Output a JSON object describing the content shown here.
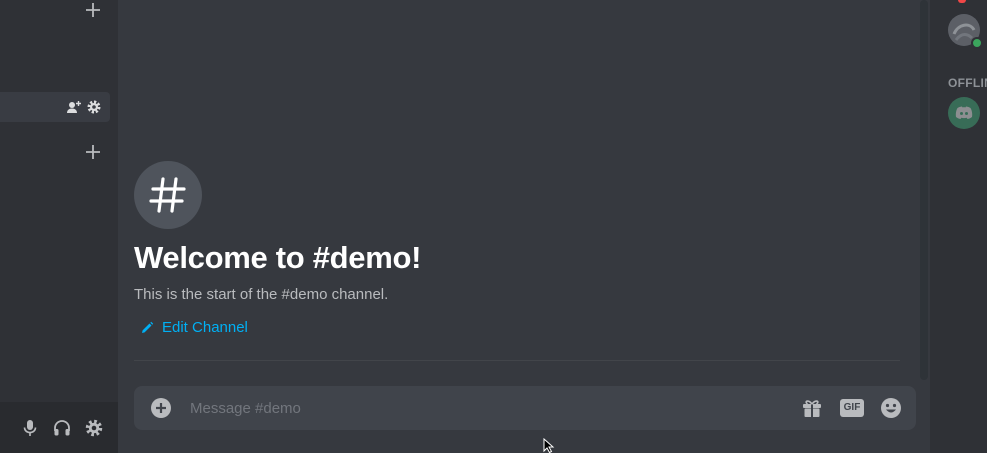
{
  "sidebar": {
    "add_top_icon": "plus-icon",
    "add_mid_icon": "plus-icon",
    "channel_row": {
      "invite_icon": "add-user-icon",
      "settings_icon": "gear-icon"
    },
    "user_panel": {
      "mic_icon": "microphone-icon",
      "headphones_icon": "headphones-icon",
      "settings_icon": "gear-icon"
    }
  },
  "chat": {
    "welcome_title": "Welcome to #demo!",
    "welcome_subtitle": "This is the start of the #demo channel.",
    "edit_channel_label": "Edit Channel",
    "channel_icon": "hash-icon"
  },
  "composer": {
    "placeholder": "Message #demo",
    "value": "",
    "gift_icon": "gift-icon",
    "gif_label": "GIF",
    "emoji_icon": "emoji-icon",
    "attach_icon": "plus-circle-icon"
  },
  "members": {
    "offline_header": "OFFLIN",
    "online_status_color": "#3ba55d"
  },
  "colors": {
    "accent_link": "#00b0f4",
    "background": "#36393f",
    "sidebar": "#2f3136"
  }
}
